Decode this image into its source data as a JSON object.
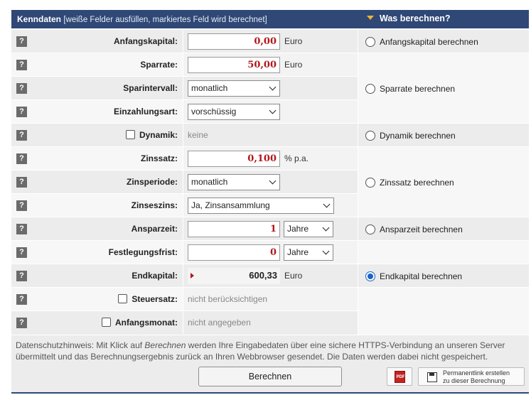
{
  "header": {
    "title": "Kenndaten",
    "subtitle": "[weiße Felder ausfüllen, markiertes Feld wird berechnet]",
    "right_title": "Was berechnen?"
  },
  "help_label": "?",
  "rows": {
    "anfangskapital": {
      "label": "Anfangskapital:",
      "value": "0,00",
      "unit": "Euro"
    },
    "sparrate": {
      "label": "Sparrate:",
      "value": "50,00",
      "unit": "Euro"
    },
    "sparintervall": {
      "label": "Sparintervall:",
      "value": "monatlich"
    },
    "einzahlungsart": {
      "label": "Einzahlungsart:",
      "value": "vorschüssig"
    },
    "dynamik": {
      "label": "Dynamik:",
      "value": "keine",
      "checked": false
    },
    "zinssatz": {
      "label": "Zinssatz:",
      "value": "0,100",
      "unit": "% p.a."
    },
    "zinsperiode": {
      "label": "Zinsperiode:",
      "value": "monatlich"
    },
    "zinseszins": {
      "label": "Zinseszins:",
      "value": "Ja, Zinsansammlung"
    },
    "ansparzeit": {
      "label": "Ansparzeit:",
      "value": "1",
      "unit_select": "Jahre"
    },
    "festlegungsfrist": {
      "label": "Festlegungsfrist:",
      "value": "0",
      "unit_select": "Jahre"
    },
    "endkapital": {
      "label": "Endkapital:",
      "value": "600,33",
      "unit": "Euro"
    },
    "steuersatz": {
      "label": "Steuersatz:",
      "value": "nicht berücksichtigen",
      "checked": false
    },
    "anfangsmonat": {
      "label": "Anfangsmonat:",
      "value": "nicht angegeben",
      "checked": false
    }
  },
  "options": {
    "anfangskapital": {
      "label": "Anfangskapital berechnen",
      "selected": false
    },
    "sparrate": {
      "label": "Sparrate berechnen",
      "selected": false
    },
    "dynamik": {
      "label": "Dynamik berechnen",
      "selected": false
    },
    "zinssatz": {
      "label": "Zinssatz berechnen",
      "selected": false
    },
    "ansparzeit": {
      "label": "Ansparzeit berechnen",
      "selected": false
    },
    "endkapital": {
      "label": "Endkapital berechnen",
      "selected": true
    }
  },
  "footer": {
    "note_prefix": "Datenschutzhinweis: Mit Klick auf ",
    "note_em": "Berechnen",
    "note_suffix": " werden Ihre Eingabedaten über eine sichere HTTPS-Verbindung an unseren Server übermittelt und das Berechnungsergebnis zurück an Ihren Webbrowser gesendet. Die Daten werden dabei nicht gespeichert.",
    "calc_button": "Berechnen",
    "pdf_label": "PDF",
    "perma_line1": "Permanentlink erstellen",
    "perma_line2": "zu dieser Berechnung"
  },
  "colors": {
    "header_bg": "#2f4876",
    "accent_triangle": "#f2b233",
    "value_red": "#b3161b",
    "radio_selected": "#1a62c9"
  }
}
